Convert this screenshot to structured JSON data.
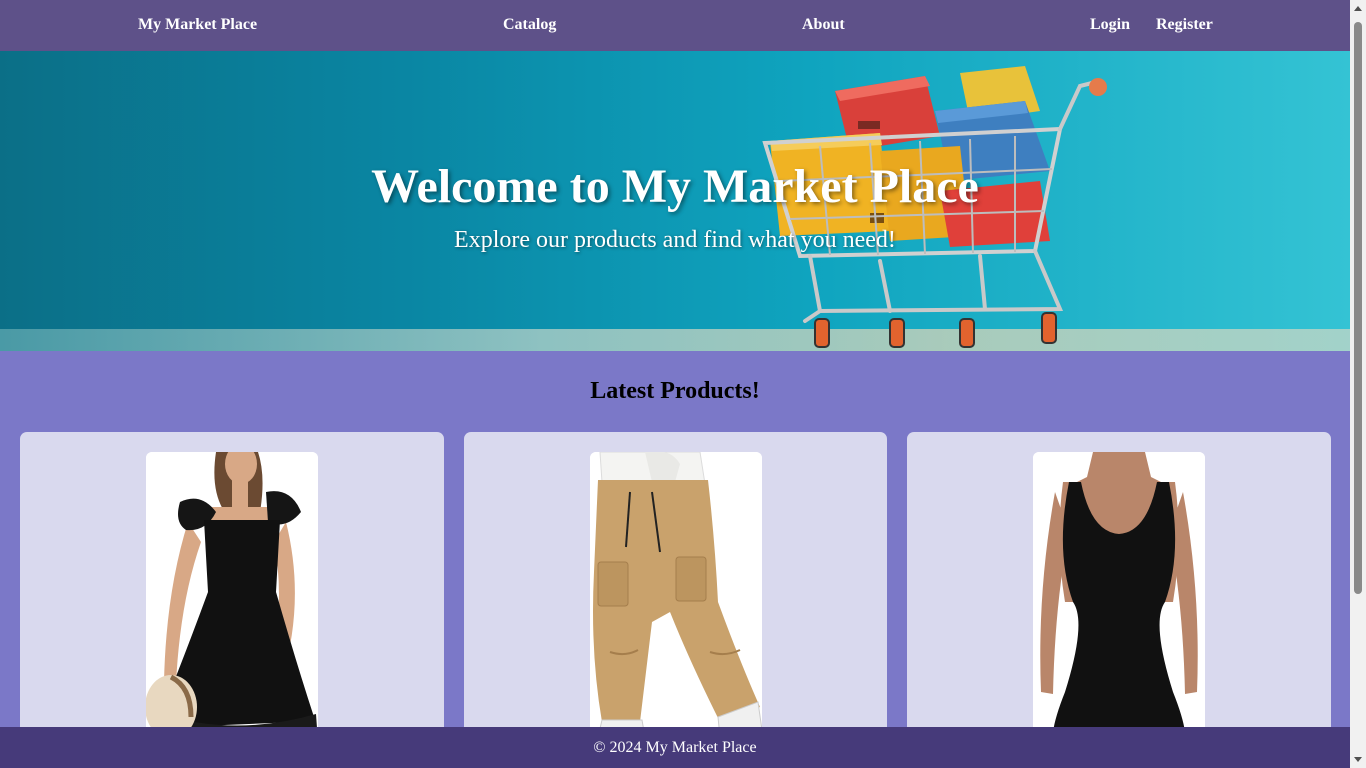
{
  "navbar": {
    "brand": "My Market Place",
    "links": [
      "Catalog",
      "About"
    ],
    "auth": [
      "Login",
      "Register"
    ],
    "background": "#5e5189"
  },
  "hero": {
    "title": "Welcome to My Market Place",
    "subtitle": "Explore our products and find what you need!",
    "image": "shopping-cart-with-boxes"
  },
  "latest": {
    "title": "Latest Products!",
    "products": [
      {
        "image": "black-ruffle-dress-photo"
      },
      {
        "image": "khaki-cargo-pants-photo"
      },
      {
        "image": "black-bodycon-dress-photo"
      }
    ]
  },
  "footer": {
    "text": "© 2024 My Market Place",
    "background": "#463a7a"
  },
  "colors": {
    "page_background": "#7b78c8",
    "card_background": "#d9d9ee"
  }
}
